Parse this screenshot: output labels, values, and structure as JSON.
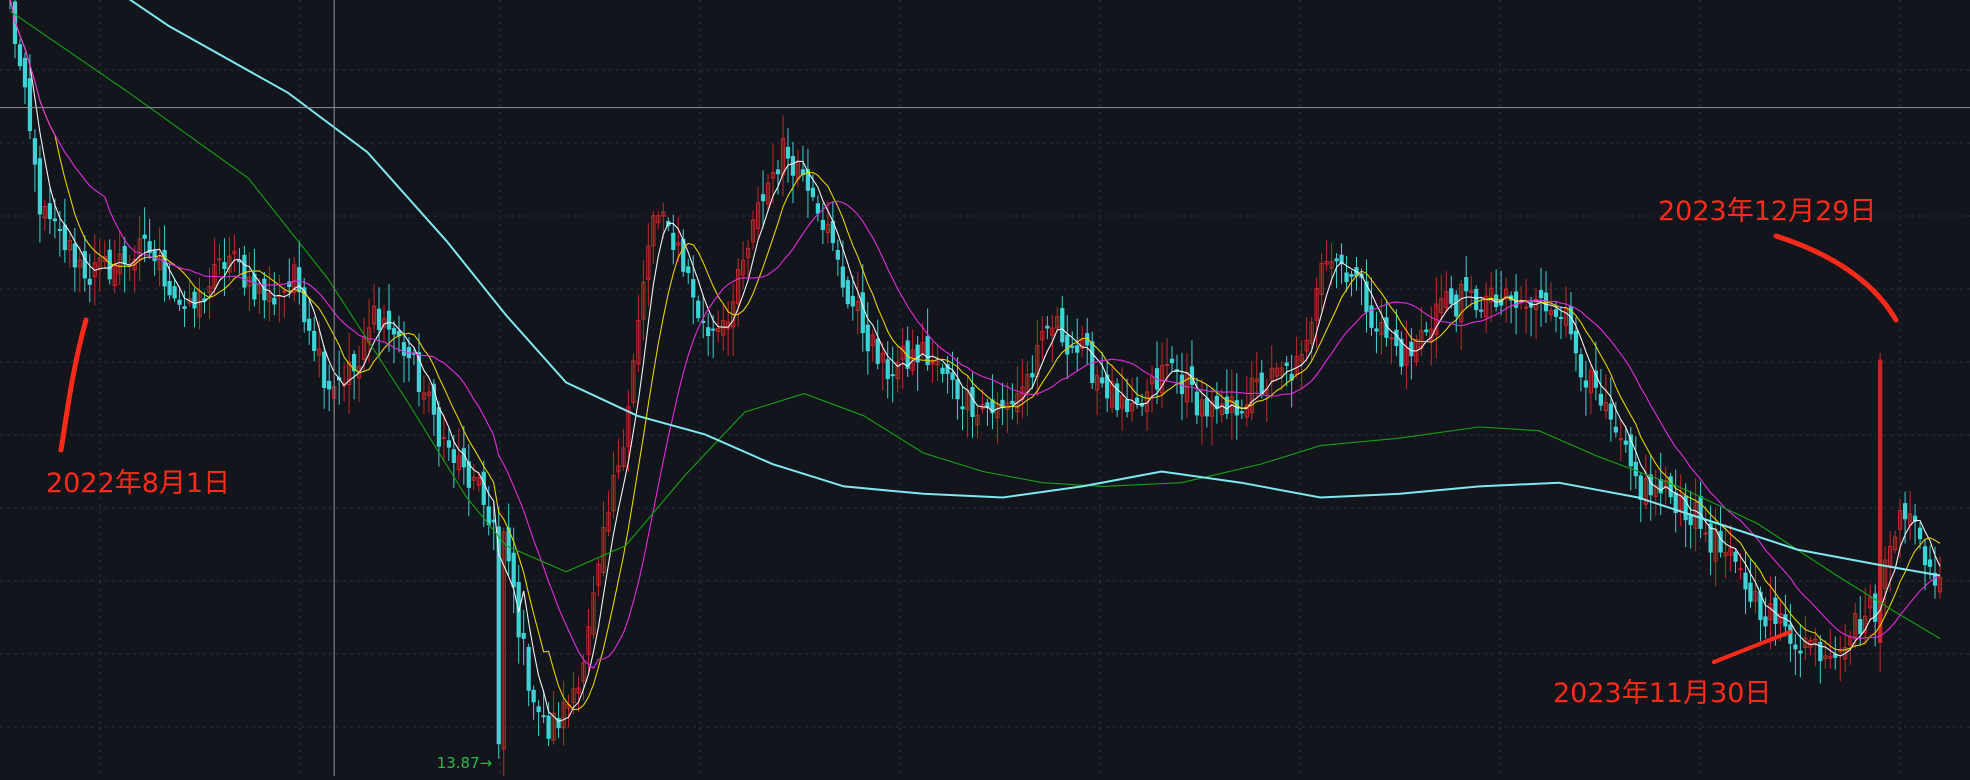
{
  "colors": {
    "background": "#12151b",
    "grid": "#2b3038",
    "crosshair": "#8f949b",
    "candle_up": "#c62828",
    "candle_down": "#3fd3d6",
    "ma_white": "#f2f2f2",
    "ma_yellow": "#e6d200",
    "ma_magenta": "#e22ce0",
    "ma_green": "#16a114",
    "ma_cyan": "#7fe8f0",
    "annotation": "#ff2a1a",
    "low_label": "#2db84b"
  },
  "chart_data": {
    "type": "candlestick",
    "title": "",
    "xlabel": "",
    "ylabel": "",
    "grid": true,
    "ylim": [
      13.4,
      34.3
    ],
    "x_range": [
      "2022-05",
      "2024-01"
    ],
    "candles": {
      "count": 388,
      "close_path": [
        [
          0,
          34.2
        ],
        [
          8,
          28.5
        ],
        [
          20,
          26.9
        ],
        [
          35,
          27.6
        ],
        [
          45,
          25.8
        ],
        [
          55,
          27.4
        ],
        [
          65,
          26.2
        ],
        [
          72,
          26.8
        ],
        [
          80,
          24.0
        ],
        [
          88,
          24.4
        ],
        [
          92,
          26.0
        ],
        [
          100,
          24.8
        ],
        [
          110,
          22.2
        ],
        [
          118,
          21.0
        ],
        [
          125,
          19.5
        ],
        [
          130,
          16.3
        ],
        [
          135,
          14.5
        ],
        [
          140,
          15.2
        ],
        [
          145,
          16.8
        ],
        [
          150,
          20.0
        ],
        [
          155,
          23.0
        ],
        [
          162,
          28.5
        ],
        [
          168,
          27.8
        ],
        [
          175,
          25.3
        ],
        [
          182,
          26.1
        ],
        [
          190,
          29.2
        ],
        [
          195,
          30.3
        ],
        [
          202,
          29.4
        ],
        [
          210,
          26.6
        ],
        [
          220,
          24.3
        ],
        [
          230,
          24.8
        ],
        [
          240,
          23.6
        ],
        [
          250,
          23.2
        ],
        [
          258,
          24.4
        ],
        [
          262,
          25.6
        ],
        [
          268,
          25.0
        ],
        [
          275,
          24.1
        ],
        [
          282,
          22.9
        ],
        [
          292,
          24.5
        ],
        [
          300,
          23.4
        ],
        [
          305,
          23.0
        ],
        [
          312,
          23.7
        ],
        [
          320,
          24.2
        ],
        [
          326,
          24.5
        ],
        [
          330,
          27.6
        ],
        [
          338,
          27.0
        ],
        [
          345,
          25.4
        ],
        [
          352,
          24.6
        ],
        [
          360,
          26.2
        ],
        [
          370,
          26.2
        ],
        [
          382,
          26.0
        ],
        [
          390,
          26.2
        ],
        [
          398,
          23.9
        ],
        [
          410,
          21.2
        ],
        [
          420,
          20.9
        ],
        [
          430,
          19.6
        ],
        [
          440,
          18.1
        ],
        [
          448,
          17.2
        ],
        [
          458,
          16.8
        ],
        [
          470,
          18.0
        ],
        [
          476,
          20.9
        ],
        [
          482,
          19.4
        ],
        [
          486,
          18.5
        ]
      ]
    },
    "moving_averages": [
      {
        "color_key": "ma_white",
        "period": 5
      },
      {
        "color_key": "ma_yellow",
        "period": 10
      },
      {
        "color_key": "ma_magenta",
        "period": 20
      },
      {
        "color_key": "ma_green",
        "period": 60
      },
      {
        "color_key": "ma_cyan",
        "period": 120
      }
    ],
    "cyan_ma_path": [
      [
        0,
        36.5
      ],
      [
        40,
        33.6
      ],
      [
        70,
        31.8
      ],
      [
        90,
        30.2
      ],
      [
        110,
        27.8
      ],
      [
        125,
        25.8
      ],
      [
        140,
        24.0
      ],
      [
        158,
        23.1
      ],
      [
        175,
        22.6
      ],
      [
        192,
        21.8
      ],
      [
        210,
        21.2
      ],
      [
        230,
        21.0
      ],
      [
        250,
        20.9
      ],
      [
        270,
        21.2
      ],
      [
        290,
        21.6
      ],
      [
        310,
        21.3
      ],
      [
        330,
        20.9
      ],
      [
        350,
        21.0
      ],
      [
        370,
        21.2
      ],
      [
        390,
        21.3
      ],
      [
        410,
        20.9
      ],
      [
        430,
        20.2
      ],
      [
        450,
        19.5
      ],
      [
        470,
        19.1
      ],
      [
        486,
        18.8
      ]
    ],
    "green_ma_path": [
      [
        0,
        34.0
      ],
      [
        30,
        31.8
      ],
      [
        60,
        29.5
      ],
      [
        80,
        26.8
      ],
      [
        100,
        23.5
      ],
      [
        115,
        20.9
      ],
      [
        125,
        19.6
      ],
      [
        140,
        18.9
      ],
      [
        155,
        19.6
      ],
      [
        170,
        21.5
      ],
      [
        185,
        23.2
      ],
      [
        200,
        23.7
      ],
      [
        215,
        23.1
      ],
      [
        230,
        22.1
      ],
      [
        245,
        21.6
      ],
      [
        260,
        21.3
      ],
      [
        275,
        21.2
      ],
      [
        295,
        21.3
      ],
      [
        315,
        21.8
      ],
      [
        330,
        22.3
      ],
      [
        350,
        22.5
      ],
      [
        370,
        22.8
      ],
      [
        385,
        22.7
      ],
      [
        400,
        22.0
      ],
      [
        420,
        21.2
      ],
      [
        440,
        20.2
      ],
      [
        460,
        18.8
      ],
      [
        475,
        17.8
      ],
      [
        486,
        17.1
      ]
    ],
    "low_marker": {
      "index": 98,
      "value": 13.87,
      "label": "13.87→"
    },
    "crosshair": {
      "index": 65,
      "value": 31.4
    },
    "annotations": [
      {
        "text": "2022年8月1日",
        "date": "2022-08-01"
      },
      {
        "text": "2023年11月30日",
        "date": "2023-11-30"
      },
      {
        "text": "2023年12月29日",
        "date": "2023-12-29"
      }
    ]
  }
}
